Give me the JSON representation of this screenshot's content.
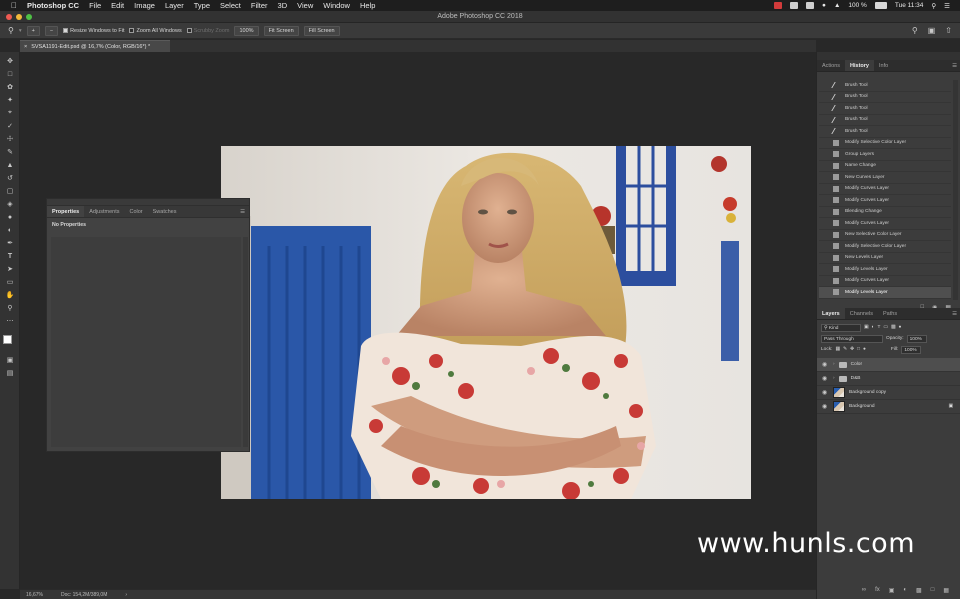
{
  "menubar": {
    "app_name": "Photoshop CC",
    "items": [
      "File",
      "Edit",
      "Image",
      "Layer",
      "Type",
      "Select",
      "Filter",
      "3D",
      "View",
      "Window",
      "Help"
    ],
    "battery": "100 %",
    "clock": "Tue 11:34"
  },
  "window": {
    "title": "Adobe Photoshop CC 2018"
  },
  "options": {
    "resize_windows": "Resize Windows to Fit",
    "zoom_all_windows": "Zoom All Windows",
    "scrubby_zoom": "Scrubby Zoom",
    "zoom_value": "100%",
    "fit_screen": "Fit Screen",
    "fill_screen": "Fill Screen"
  },
  "document": {
    "tab_title": "SVSA1191-Edit.psd @ 16,7% (Color, RGB/16*) *"
  },
  "status": {
    "zoom": "16,67%",
    "doc_size": "Doc: 154,2M/389,0M"
  },
  "properties_panel": {
    "tabs": [
      "Properties",
      "Adjustments",
      "Color",
      "Swatches"
    ],
    "active_tab": "Properties",
    "message": "No Properties"
  },
  "history_panel": {
    "tabs": [
      "Actions",
      "History",
      "Info"
    ],
    "active_tab": "History",
    "items": [
      {
        "label": "Brush Tool",
        "icon": "brush-icon"
      },
      {
        "label": "Brush Tool",
        "icon": "brush-icon"
      },
      {
        "label": "Brush Tool",
        "icon": "brush-icon"
      },
      {
        "label": "Brush Tool",
        "icon": "brush-icon"
      },
      {
        "label": "Brush Tool",
        "icon": "brush-icon"
      },
      {
        "label": "Modify Selective Color Layer",
        "icon": "history-state-icon"
      },
      {
        "label": "Group Layers",
        "icon": "history-state-icon"
      },
      {
        "label": "Name Change",
        "icon": "history-state-icon"
      },
      {
        "label": "New Curves Layer",
        "icon": "history-state-icon"
      },
      {
        "label": "Modify Curves Layer",
        "icon": "history-state-icon"
      },
      {
        "label": "Modify Curves Layer",
        "icon": "history-state-icon"
      },
      {
        "label": "Blending Change",
        "icon": "history-state-icon"
      },
      {
        "label": "Modify Curves Layer",
        "icon": "history-state-icon"
      },
      {
        "label": "New Selective Color Layer",
        "icon": "history-state-icon"
      },
      {
        "label": "Modify Selective Color Layer",
        "icon": "history-state-icon"
      },
      {
        "label": "New Levels Layer",
        "icon": "history-state-icon"
      },
      {
        "label": "Modify Levels Layer",
        "icon": "history-state-icon"
      },
      {
        "label": "Modify Curves Layer",
        "icon": "history-state-icon"
      },
      {
        "label": "Modify Levels Layer",
        "icon": "history-state-icon"
      }
    ]
  },
  "layers_panel": {
    "tabs": [
      "Layers",
      "Channels",
      "Paths"
    ],
    "active_tab": "Layers",
    "filter_kind": "Kind",
    "blend_mode": "Pass Through",
    "opacity_label": "Opacity:",
    "opacity_value": "100%",
    "lock_label": "Lock:",
    "fill_label": "Fill:",
    "fill_value": "100%",
    "layers": [
      {
        "name": "Color",
        "type": "group"
      },
      {
        "name": "D&B",
        "type": "group"
      },
      {
        "name": "Background copy",
        "type": "pixel"
      },
      {
        "name": "Background",
        "type": "pixel"
      }
    ]
  },
  "watermark": "www.hunls.com",
  "colors": {
    "accent_red": "#ee5a52",
    "accent_yellow": "#f2b83a",
    "accent_green": "#4fc145",
    "door_blue": "#2a57a8"
  }
}
